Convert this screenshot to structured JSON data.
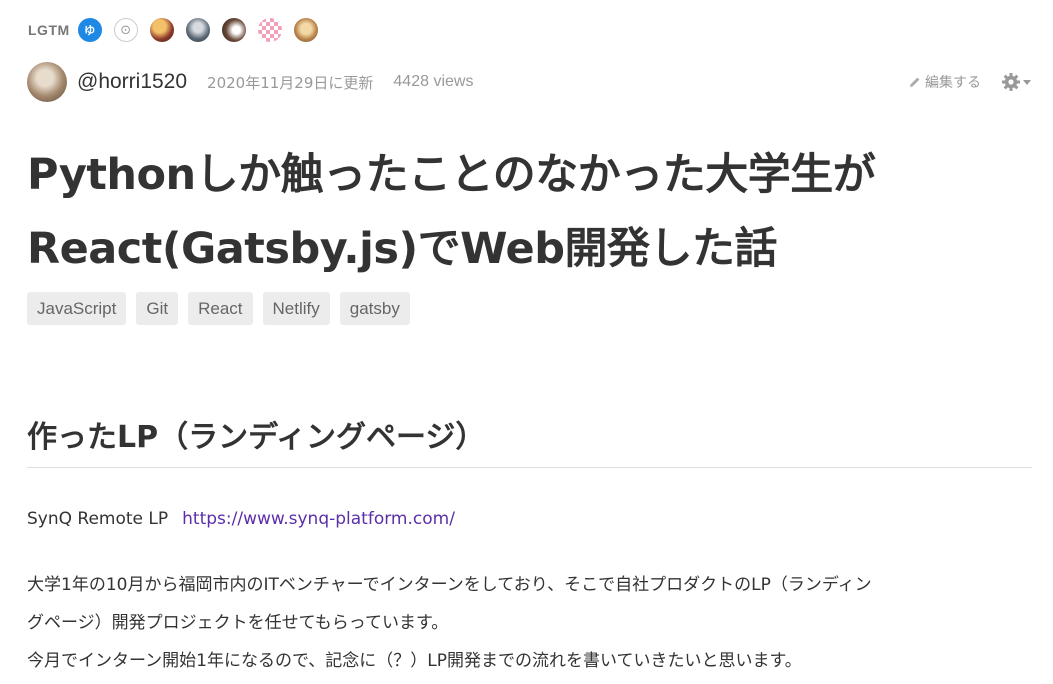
{
  "lgtm": {
    "label": "LGTM",
    "avatars": [
      {
        "icon": "user-avatar-icon",
        "text": "ゆ"
      },
      {
        "icon": "user-avatar-icon",
        "text": "⊙"
      },
      {
        "icon": "user-avatar-icon"
      },
      {
        "icon": "user-avatar-icon"
      },
      {
        "icon": "user-avatar-icon"
      },
      {
        "icon": "user-avatar-icon"
      },
      {
        "icon": "user-avatar-icon"
      }
    ]
  },
  "meta": {
    "author": "@horri1520",
    "updated": "2020年11月29日に更新",
    "views": "4428 views",
    "edit_label": "編集する"
  },
  "article": {
    "title_line1": "Pythonしか触ったことのなかった大学生が",
    "title_line2": "React(Gatsby.js)でWeb開発した話",
    "tags": [
      "JavaScript",
      "Git",
      "React",
      "Netlify",
      "gatsby"
    ],
    "section_heading": "作ったLP（ランディングページ）",
    "lp_name": "SynQ Remote LP",
    "lp_url": "https://www.synq-platform.com/",
    "paragraph_line1": "大学1年の10月から福岡市内のITベンチャーでインターンをしており、そこで自社プロダクトのLP（ランディン",
    "paragraph_line2": "グページ）開発プロジェクトを任せてもらっています。",
    "paragraph_line3": "今月でインターン開始1年になるので、記念に（？）LP開発までの流れを書いていきたいと思います。"
  },
  "colors": {
    "text": "#333333",
    "muted": "#999999",
    "link": "#5c2fa8",
    "tag_bg": "#ececec"
  }
}
